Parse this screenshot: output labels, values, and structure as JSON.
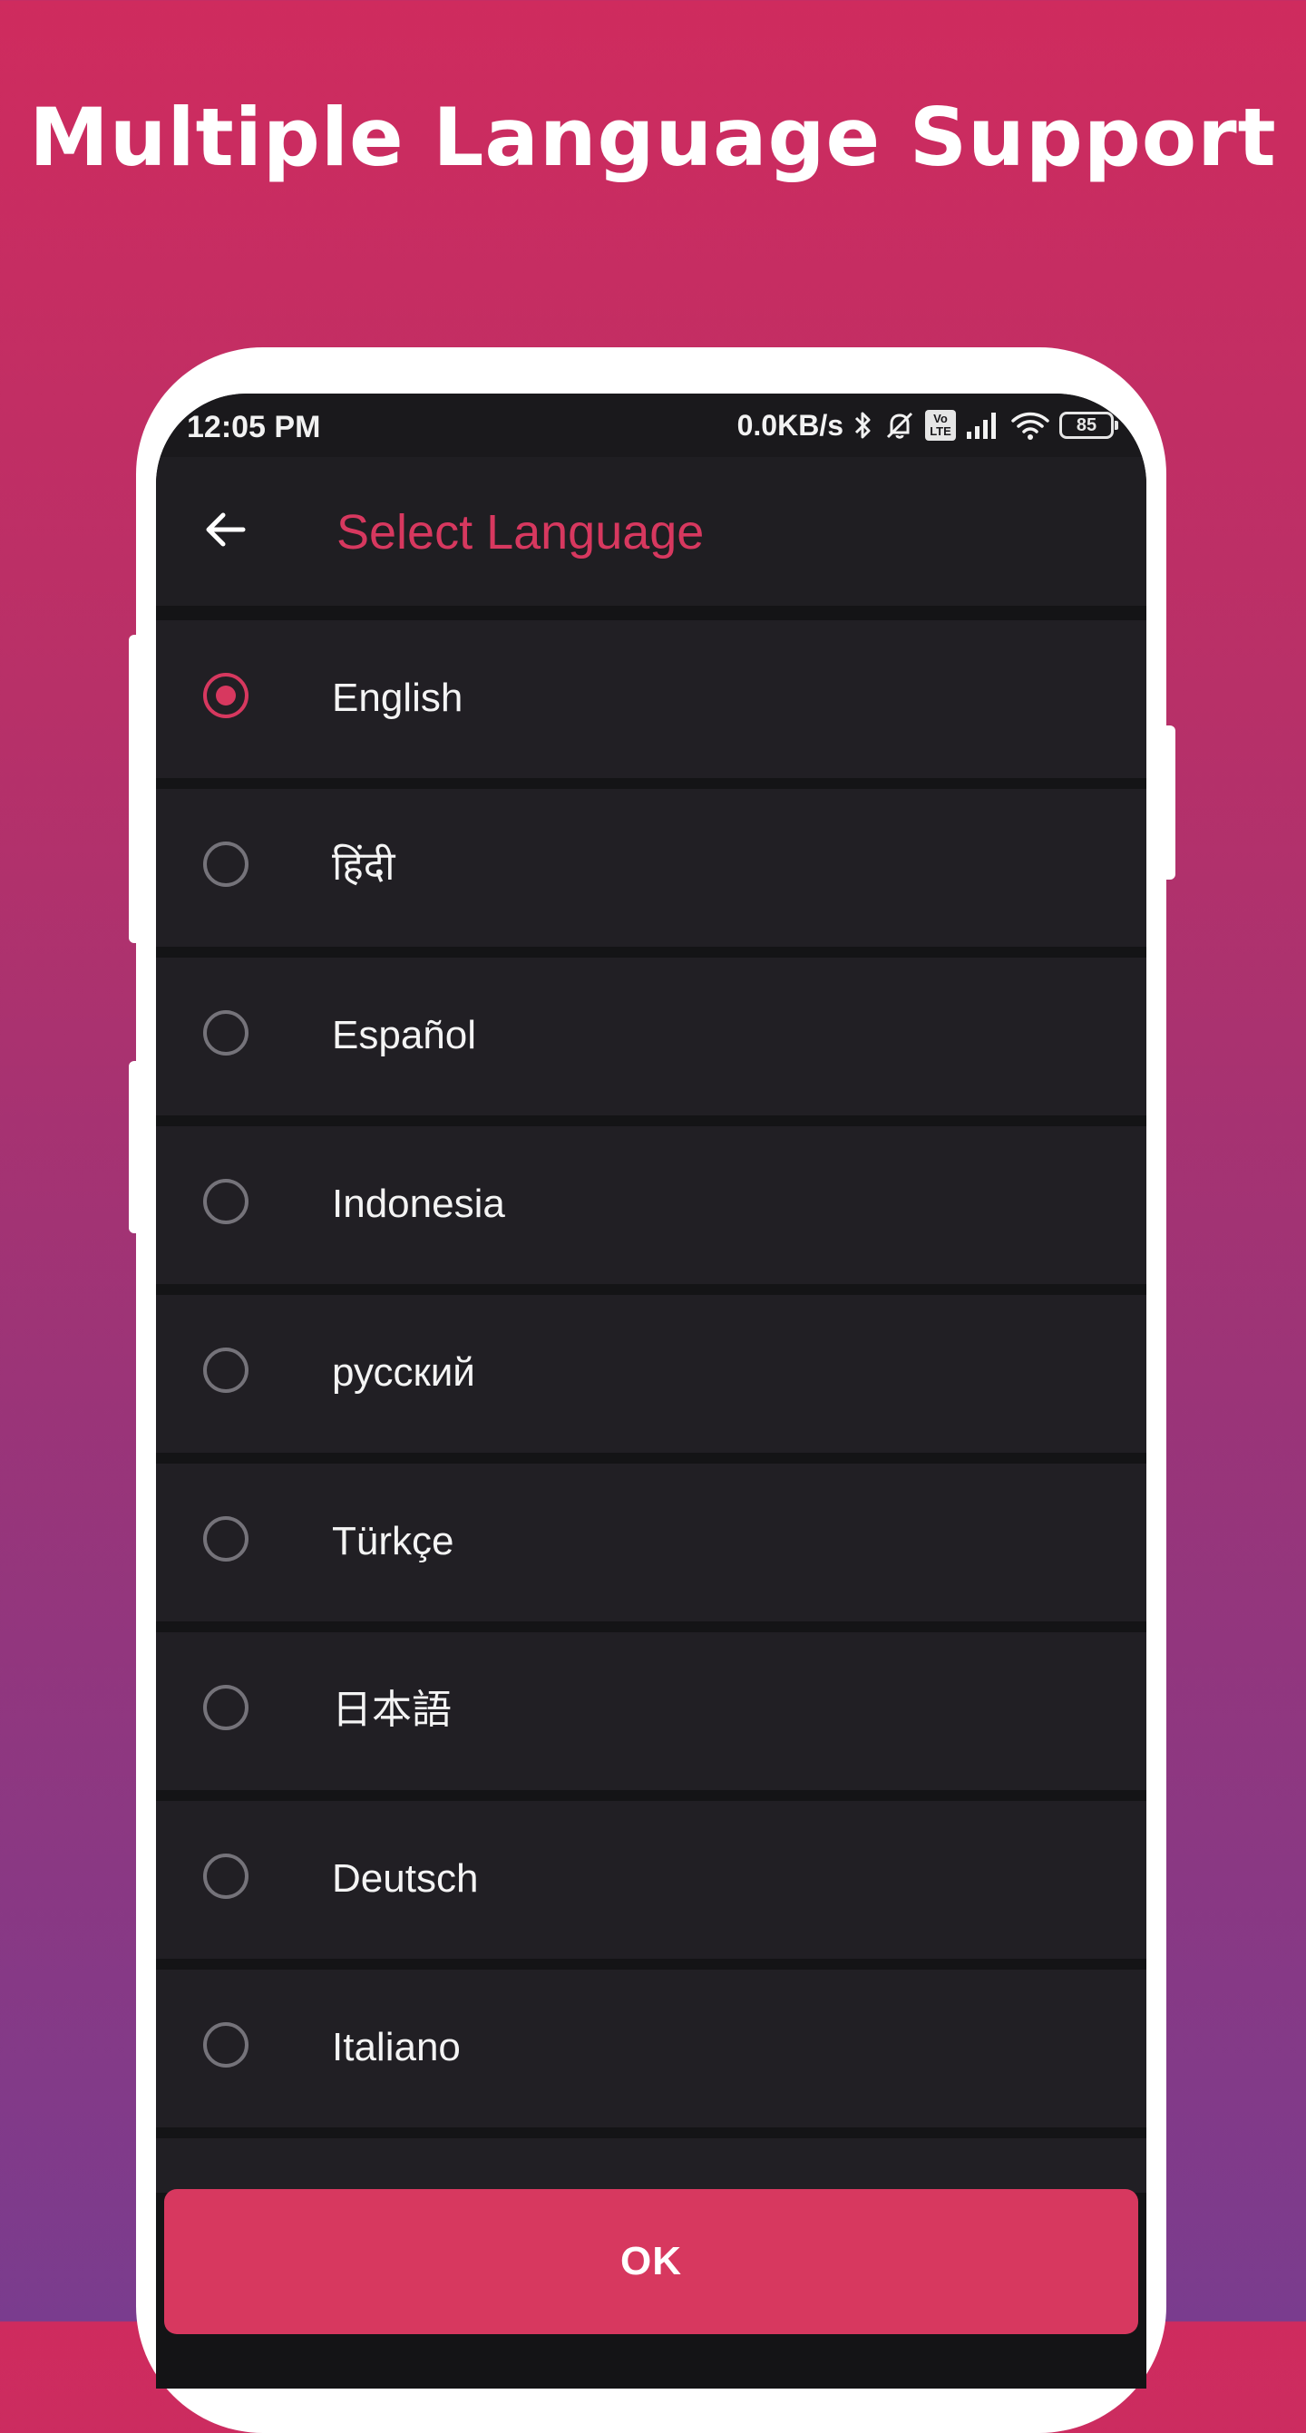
{
  "promo": {
    "headline": "Multiple Language Support"
  },
  "status_bar": {
    "time": "12:05 PM",
    "network_speed": "0.0KB/s",
    "volte_top": "Vo",
    "volte_bottom": "LTE",
    "battery": "85",
    "icons": [
      "bluetooth-icon",
      "bell-off-icon",
      "volte-icon",
      "signal-icon",
      "wifi-icon",
      "battery-icon"
    ]
  },
  "app_bar": {
    "title": "Select Language",
    "back_icon": "arrow-left-icon"
  },
  "languages": [
    {
      "label": "English",
      "selected": true
    },
    {
      "label": "हिंदी",
      "selected": false
    },
    {
      "label": "Español",
      "selected": false
    },
    {
      "label": "Indonesia",
      "selected": false
    },
    {
      "label": "русский",
      "selected": false
    },
    {
      "label": "Türkçe",
      "selected": false
    },
    {
      "label": "日本語",
      "selected": false
    },
    {
      "label": "Deutsch",
      "selected": false
    },
    {
      "label": "Italiano",
      "selected": false
    }
  ],
  "ok_button": {
    "label": "OK"
  },
  "colors": {
    "accent": "#d7385f",
    "background_top": "#cf2b5e",
    "background_bottom": "#7a3c8e",
    "list_item": "#211f24",
    "divider": "#141416"
  }
}
